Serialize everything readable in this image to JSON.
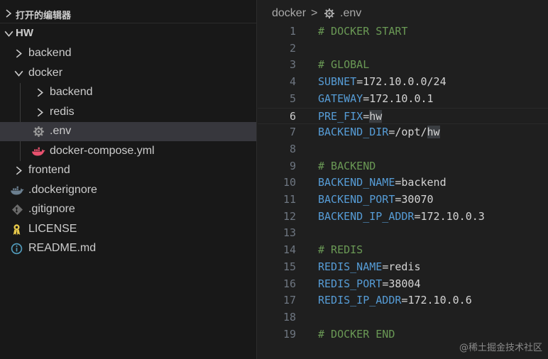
{
  "explorer": {
    "section_title": "打开的编辑器",
    "root": "HW",
    "items": [
      {
        "label": "backend"
      },
      {
        "label": "docker"
      },
      {
        "label": "backend"
      },
      {
        "label": "redis"
      },
      {
        "label": ".env"
      },
      {
        "label": "docker-compose.yml"
      },
      {
        "label": "frontend"
      },
      {
        "label": ".dockerignore"
      },
      {
        "label": ".gitignore"
      },
      {
        "label": "LICENSE"
      },
      {
        "label": "README.md"
      }
    ]
  },
  "breadcrumb": {
    "folder": "docker",
    "separator": ">",
    "file": ".env"
  },
  "editor": {
    "lines": [
      {
        "n": "1",
        "comment": "# DOCKER START"
      },
      {
        "n": "2"
      },
      {
        "n": "3",
        "comment": "# GLOBAL"
      },
      {
        "n": "4",
        "key": "SUBNET",
        "eq": "=",
        "value": "172.10.0.0/24"
      },
      {
        "n": "5",
        "key": "GATEWAY",
        "eq": "=",
        "value": "172.10.0.1"
      },
      {
        "n": "6",
        "key": "PRE_FIX",
        "eq": "=",
        "value": "hw",
        "highlight": "hw"
      },
      {
        "n": "7",
        "key": "BACKEND_DIR",
        "eq": "=",
        "value": "/opt/",
        "highlight": "hw"
      },
      {
        "n": "8"
      },
      {
        "n": "9",
        "comment": "# BACKEND"
      },
      {
        "n": "10",
        "key": "BACKEND_NAME",
        "eq": "=",
        "value": "backend"
      },
      {
        "n": "11",
        "key": "BACKEND_PORT",
        "eq": "=",
        "value": "30070"
      },
      {
        "n": "12",
        "key": "BACKEND_IP_ADDR",
        "eq": "=",
        "value": "172.10.0.3"
      },
      {
        "n": "13"
      },
      {
        "n": "14",
        "comment": "# REDIS"
      },
      {
        "n": "15",
        "key": "REDIS_NAME",
        "eq": "=",
        "value": "redis"
      },
      {
        "n": "16",
        "key": "REDIS_PORT",
        "eq": "=",
        "value": "38004"
      },
      {
        "n": "17",
        "key": "REDIS_IP_ADDR",
        "eq": "=",
        "value": "172.10.0.6"
      },
      {
        "n": "18"
      },
      {
        "n": "19",
        "comment": "# DOCKER END"
      }
    ],
    "current_line": "6"
  },
  "watermark": "@稀土掘金技术社区",
  "colors": {
    "comment": "#6a9955",
    "key": "#569cd6",
    "docker_icon": "#2496ed",
    "compose_icon": "#e8516e",
    "license_icon": "#e6c84a",
    "readme_icon": "#519aba"
  },
  "icons": {
    "env": "gear-icon",
    "docker_compose": "docker-icon",
    "dockerignore": "docker-icon",
    "gitignore": "git-icon",
    "license": "license-icon",
    "readme": "info-icon"
  }
}
